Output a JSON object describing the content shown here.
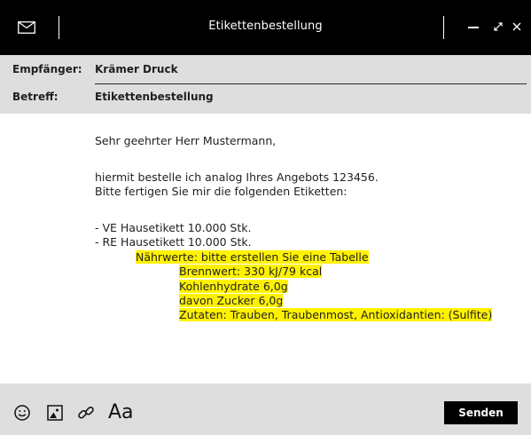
{
  "window": {
    "title": "Etikettenbestellung",
    "icon": "mail-icon",
    "controls": [
      "minimize-icon",
      "expand-icon",
      "close-icon"
    ]
  },
  "headers": {
    "recipient_label": "Empfänger:",
    "recipient_value": "Krämer Druck",
    "subject_label": "Betreff:",
    "subject_value": "Etikettenbestellung"
  },
  "body": {
    "greeting": "Sehr geehrter Herr Mustermann,",
    "line1": "hiermit bestelle ich analog Ihres Angebots 123456.",
    "line2": "Bitte fertigen Sie mir die folgenden Etiketten:",
    "item1": "- VE Hausetikett 10.000 Stk.",
    "item2": "- RE Hausetikett 10.000 Stk.",
    "nutrition": "Nährwerte: bitte erstellen Sie eine Tabelle",
    "energy": "Brennwert: 330 kJ/79 kcal",
    "carbs": "Kohlenhydrate 6,0g",
    "sugar": "davon Zucker 6,0g",
    "ingredients": "Zutaten: Trauben, Traubenmost, Antioxidantien: (Sulfite)"
  },
  "toolbar": {
    "icons": [
      "emoji-icon",
      "image-icon",
      "link-icon"
    ],
    "font_label": "Aa",
    "send_label": "Senden"
  },
  "colors": {
    "titlebar": "#000000",
    "header_bg": "#dedede",
    "highlight": "#fff200",
    "send_button": "#000000"
  }
}
